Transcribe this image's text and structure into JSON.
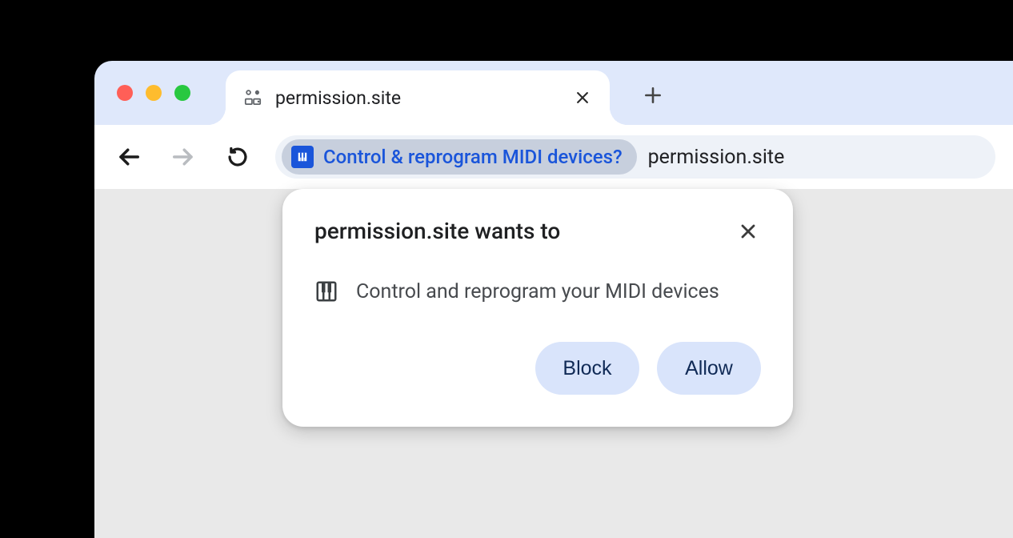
{
  "tab": {
    "title": "permission.site"
  },
  "omnibox": {
    "chip_label": "Control & reprogram MIDI devices?",
    "url": "permission.site"
  },
  "popup": {
    "title": "permission.site wants to",
    "permission_text": "Control and reprogram your MIDI devices",
    "block_label": "Block",
    "allow_label": "Allow"
  }
}
